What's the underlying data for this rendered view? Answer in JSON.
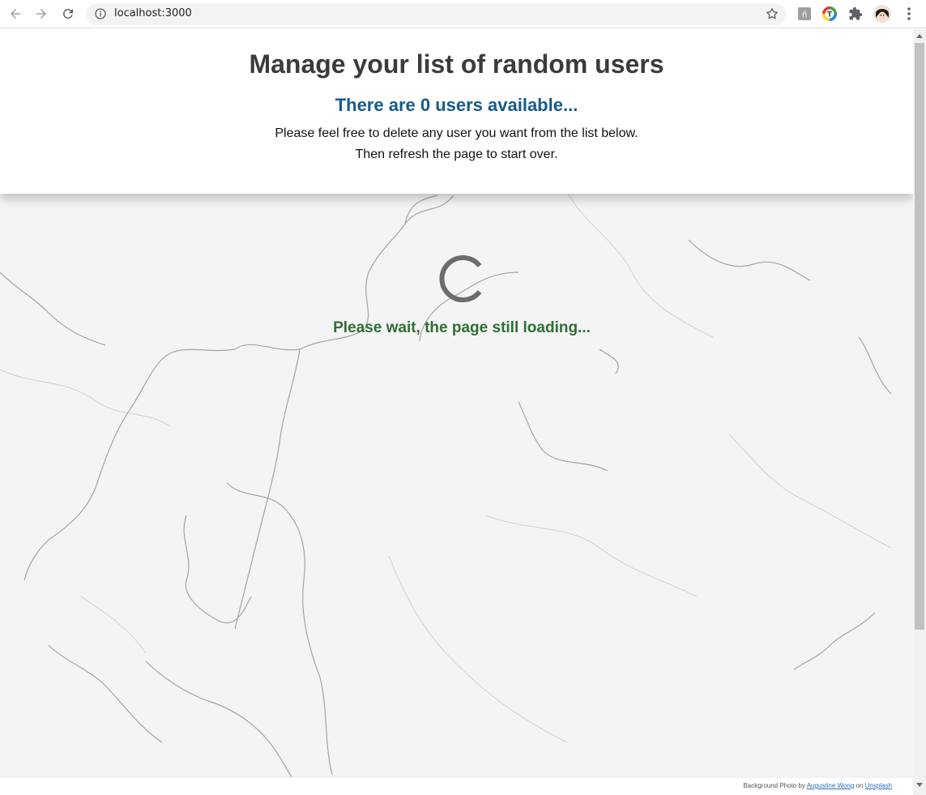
{
  "browser": {
    "url": "localhost:3000",
    "icons": {
      "back": "back-arrow-icon",
      "forward": "forward-arrow-icon",
      "reload": "reload-icon",
      "site_info": "info-icon",
      "bookmark": "star-icon",
      "extensions": "puzzle-icon",
      "menu": "kebab-menu-icon"
    }
  },
  "header": {
    "title": "Manage your list of random users",
    "user_count_text": "There are 0 users available...",
    "instruction_line1": "Please feel free to delete any user you want from the list below.",
    "instruction_line2": "Then refresh the page to start over."
  },
  "loading": {
    "text": "Please wait, the page still loading..."
  },
  "footer": {
    "credit_prefix": "Background Photo by",
    "photographer": "Augustine Wong",
    "credit_middle": "on",
    "source": "Unsplash"
  },
  "colors": {
    "title": "#3b3b3b",
    "user_count": "#155a8a",
    "loading_text": "#2f6e35",
    "spinner": "#6b6b70"
  }
}
